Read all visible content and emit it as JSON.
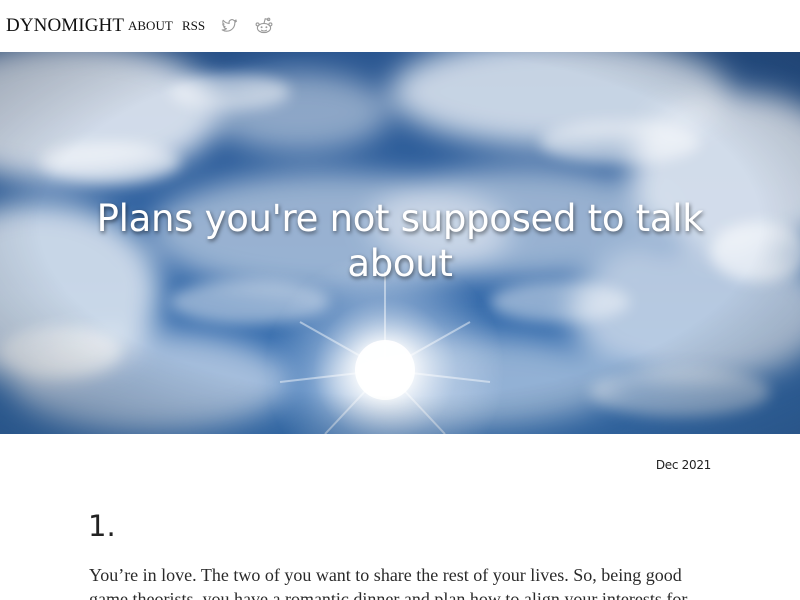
{
  "nav": {
    "brand": "DYNOMIGHT",
    "links": [
      "ABOUT",
      "RSS"
    ],
    "icons": [
      "twitter-icon",
      "reddit-icon"
    ],
    "icon_color": "#9a9a9a"
  },
  "hero": {
    "title": "Plans you're not supposed to talk about",
    "sky_color": "#2f5f9c",
    "cloud_color": "#f2f4f7"
  },
  "article": {
    "date": "Dec 2021",
    "section_heading": "1.",
    "paragraph": "You’re in love. The two of you want to share the rest of your lives. So, being good game theorists, you have a romantic dinner and plan how to align your interests for"
  }
}
